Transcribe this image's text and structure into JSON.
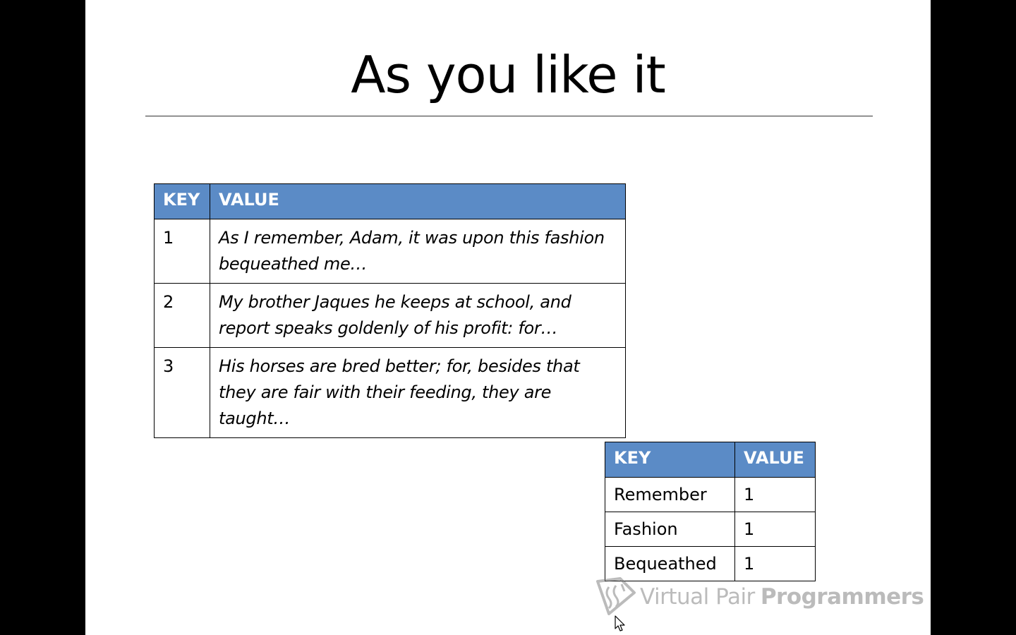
{
  "slide": {
    "title": "As you like it"
  },
  "table_main": {
    "headers": {
      "key": "KEY",
      "value": "VALUE"
    },
    "rows": [
      {
        "key": "1",
        "value": "As I remember, Adam, it was upon this fashion bequeathed me…"
      },
      {
        "key": "2",
        "value": "My brother Jaques he keeps at school, and report speaks goldenly of his profit: for…"
      },
      {
        "key": "3",
        "value": "His horses are bred better; for, besides that they are fair with their feeding, they are taught…"
      }
    ]
  },
  "table_counts": {
    "headers": {
      "key": "KEY",
      "value": "VALUE"
    },
    "rows": [
      {
        "key": "Remember",
        "value": "1"
      },
      {
        "key": "Fashion",
        "value": "1"
      },
      {
        "key": "Bequeathed",
        "value": "1"
      }
    ]
  },
  "watermark": {
    "text_light": "Virtual Pair",
    "text_bold": "Programmers",
    "icon": "vpp-logo-icon"
  },
  "cursor": {
    "icon": "mouse-pointer-icon"
  },
  "colors": {
    "header_bg": "#5b8bc6",
    "header_text": "#ffffff",
    "border": "#000000",
    "background": "#ffffff",
    "frame": "#000000"
  }
}
